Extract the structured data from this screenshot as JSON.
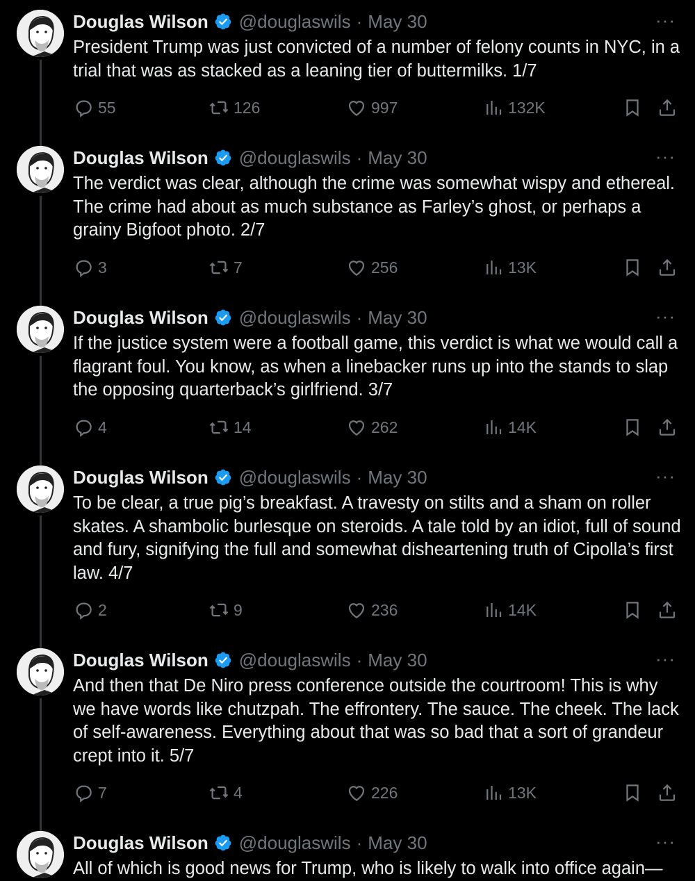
{
  "tweets": [
    {
      "author": "Douglas Wilson",
      "handle": "@douglaswils",
      "separator": "·",
      "date": "May 30",
      "more": "···",
      "text": "President Trump was just convicted of a number of felony counts in NYC, in a trial that was as stacked as a leaning tier of buttermilks. 1/7",
      "replies": "55",
      "reposts": "126",
      "likes": "997",
      "views": "132K"
    },
    {
      "author": "Douglas Wilson",
      "handle": "@douglaswils",
      "separator": "·",
      "date": "May 30",
      "more": "···",
      "text": "The verdict was clear, although the crime was somewhat wispy and ethereal. The crime had about as much substance as Farley’s ghost, or perhaps a grainy Bigfoot photo. 2/7",
      "replies": "3",
      "reposts": "7",
      "likes": "256",
      "views": "13K"
    },
    {
      "author": "Douglas Wilson",
      "handle": "@douglaswils",
      "separator": "·",
      "date": "May 30",
      "more": "···",
      "text": "If the justice system were a football game, this verdict is what we would call a flagrant foul. You know, as when a linebacker runs up into the stands to slap the opposing quarterback’s girlfriend. 3/7",
      "replies": "4",
      "reposts": "14",
      "likes": "262",
      "views": "14K"
    },
    {
      "author": "Douglas Wilson",
      "handle": "@douglaswils",
      "separator": "·",
      "date": "May 30",
      "more": "···",
      "text": "To be clear, a true pig’s breakfast. A travesty on stilts and a sham on roller skates. A shambolic burlesque on steroids. A tale told by an idiot, full of sound and fury, signifying the full and somewhat disheartening truth of Cipolla’s first law. 4/7",
      "replies": "2",
      "reposts": "9",
      "likes": "236",
      "views": "14K"
    },
    {
      "author": "Douglas Wilson",
      "handle": "@douglaswils",
      "separator": "·",
      "date": "May 30",
      "more": "···",
      "text": "And then that De Niro press conference outside the courtroom! This is why we have words like chutzpah. The effrontery. The sauce. The cheek. The lack of self-awareness. Everything about that was so bad that a sort of grandeur crept into it. 5/7",
      "replies": "7",
      "reposts": "4",
      "likes": "226",
      "views": "13K"
    },
    {
      "author": "Douglas Wilson",
      "handle": "@douglaswils",
      "separator": "·",
      "date": "May 30",
      "more": "···",
      "text": "All of which is good news for Trump, who is likely to walk into office again—"
    }
  ],
  "colors": {
    "background": "#000000",
    "text": "#e7e9ea",
    "muted": "#71767b",
    "verified": "#1d9bf0",
    "thread_line": "#333639"
  },
  "icons": [
    "reply-icon",
    "repost-icon",
    "like-icon",
    "views-icon",
    "bookmark-icon",
    "share-icon",
    "verified-badge-icon",
    "more-icon"
  ]
}
